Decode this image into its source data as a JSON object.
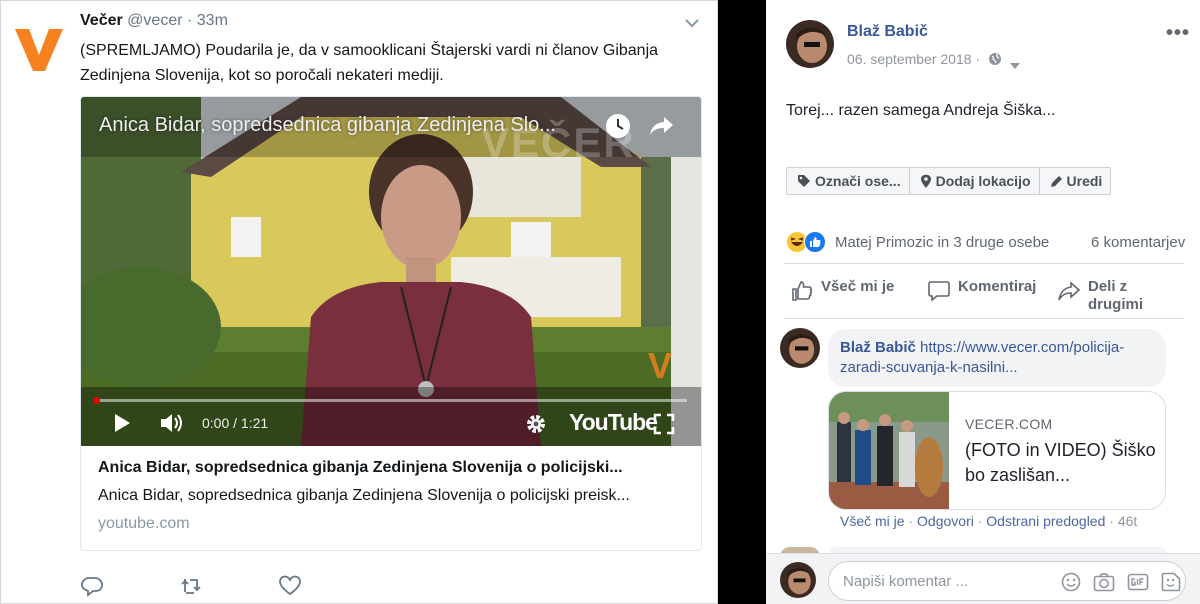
{
  "tweet": {
    "author_name": "Večer",
    "handle": "@vecer",
    "separator": " · ",
    "time": "33m",
    "logo_letter": "V",
    "text": "(SPREMLJAMO) Poudarila je, da v samooklicani Štajerski vardi ni članov Gibanja Zedinjena Slovenija, kot so poročali nekateri mediji.",
    "card": {
      "video_title": "Anica Bidar, sopredsednica gibanja Zedinjena Slo...",
      "watermark_text": "VEČER",
      "corner_logo": "V",
      "time_display": "0:00 / 1:21",
      "player_brand": "YouTube",
      "title": "Anica Bidar, sopredsednica gibanja Zedinjena Slovenija o policijski...",
      "description": "Anica Bidar, sopredsednica gibanja Zedinjena Slovenija o policijski preisk...",
      "domain": "youtube.com"
    },
    "accent_color": "#f5821f"
  },
  "facebook": {
    "author_name": "Blaž Babič",
    "date": "06. september 2018 ·",
    "more": "•••",
    "post_text": "Torej... razen samega Andreja Šiška...",
    "tag_buttons": [
      "Označi ose...",
      "Dodaj lokacijo",
      "Uredi"
    ],
    "reactions_text": "Matej Primozic in 3 druge osebe",
    "comments_count": "6 komentarjev",
    "actions": {
      "like": "Všeč mi je",
      "comment": "Komentiraj",
      "share_line1": "Deli z",
      "share_line2": "drugimi"
    },
    "comment": {
      "author": "Blaž Babič",
      "link_text": "https://www.vecer.com/policija-zaradi-scuvanja-k-nasilni...",
      "preview_domain": "VECER.COM",
      "preview_title": "(FOTO in VIDEO) Šiško bo zaslišan...",
      "action_like": "Všeč mi je",
      "action_reply": "Odgovori",
      "action_remove": "Odstrani predogled",
      "ago": "46t",
      "dot": " · "
    },
    "composer_placeholder": "Napiši komentar ...",
    "link_color": "#385898"
  }
}
